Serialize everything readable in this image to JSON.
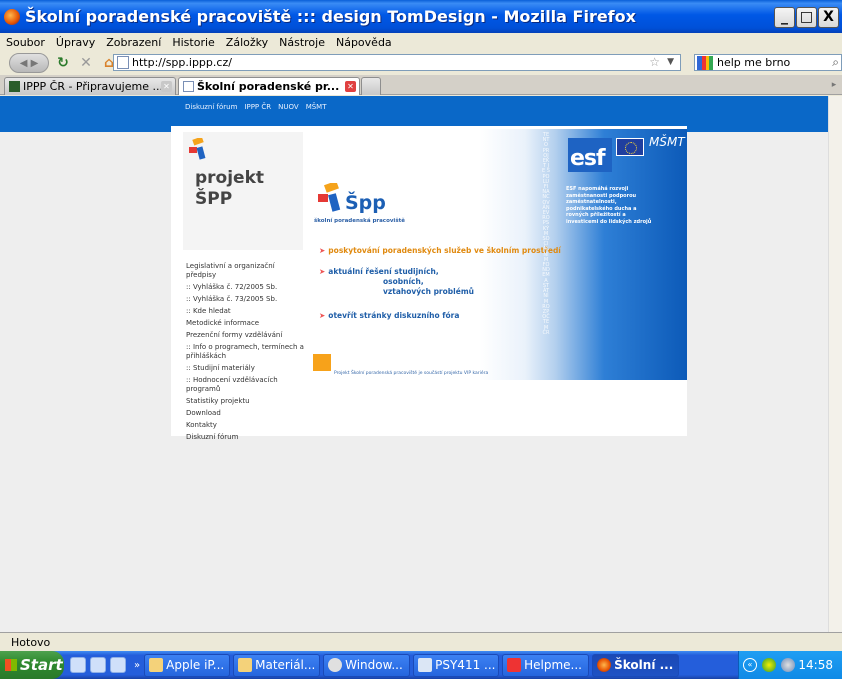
{
  "window": {
    "title": "Školní poradenské pracoviště ::: design TomDesign - Mozilla Firefox",
    "minimize": "_",
    "maximize": "□",
    "close": "X"
  },
  "menu": [
    "Soubor",
    "Úpravy",
    "Zobrazení",
    "Historie",
    "Záložky",
    "Nástroje",
    "Nápověda"
  ],
  "url": "http://spp.ippp.cz/",
  "search_value": "help me brno",
  "tabs": [
    {
      "label": "IPPP ČR - Připravujeme ..."
    },
    {
      "label": "Školní poradenské pr..."
    }
  ],
  "site": {
    "top_nav": [
      "Diskuzní fórum",
      "IPPP ČR",
      "NUOV",
      "MŠMT"
    ],
    "logo_text_1": "projekt",
    "logo_text_2": "ŠPP",
    "side_menu": [
      "Legislativní a organizační předpisy",
      ":: Vyhláška č. 72/2005 Sb.",
      ":: Vyhláška č. 73/2005 Sb.",
      ":: Kde hledat",
      "Metodické informace",
      "Prezenční formy vzdělávání",
      ":: Info o programech, termínech a přihláškách",
      ":: Studijní materiály",
      ":: Hodnocení vzdělávacích programů",
      "Statistiky projektu",
      "Download",
      "Kontakty",
      "Diskuzní fórum"
    ],
    "banner": {
      "brand": "Špp",
      "brand_sub": "školní poradenská pracoviště",
      "link1": "poskytování poradenských služeb ve školním prostředí",
      "link2_l1": "aktuální řešení studijních,",
      "link2_l2": "osobních,",
      "link2_l3": "vztahových problémů",
      "link3": "otevřít stránky diskuzního fóra",
      "vertical_text": "TENTO PROJEKT JE SPOLUFINANCOVÁN EVROPSKÝM SOCIÁLNÍM FONDEM A STÁTNÍM ROZPOČTEM ČR",
      "esf": "esf",
      "msmt": "MŠMT",
      "esf_text": "ESF napomáhá rozvoji zaměstnanosti podporou zaměstnatelnosti, podnikatelského ducha a rovných příležitostí a investicemi do lidských zdrojů",
      "footer": "Projekt Školní poradenská pracoviště je součástí projektu VIP kariéra"
    }
  },
  "status": "Hotovo",
  "taskbar": {
    "start": "Start",
    "buttons": [
      "Apple iP...",
      "Materiál...",
      "Window...",
      "PSY411 ...",
      "Helpme...",
      "Školní ..."
    ],
    "clock": "14:58"
  }
}
